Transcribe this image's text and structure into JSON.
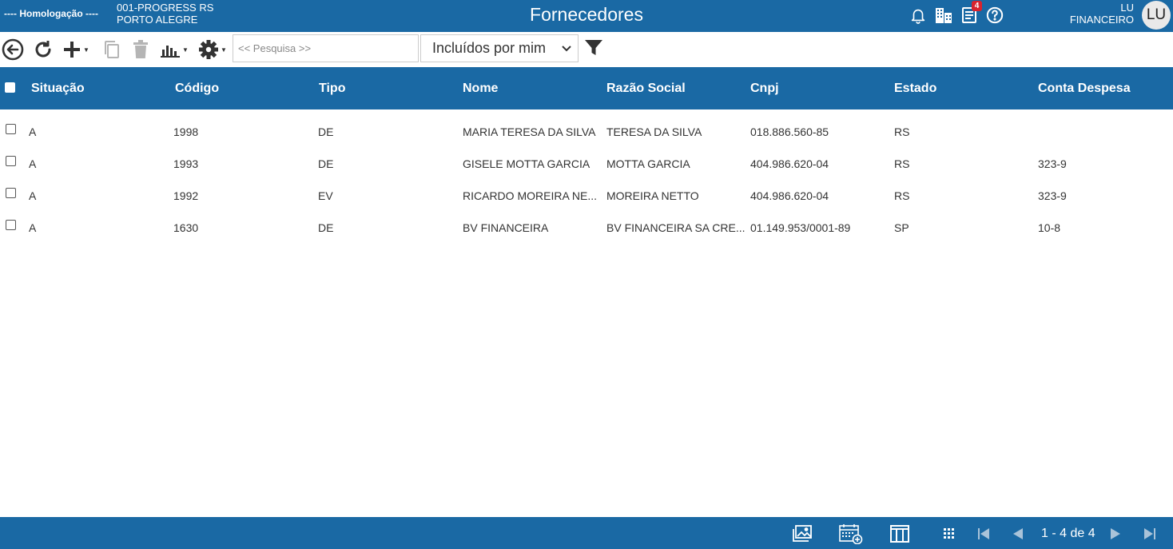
{
  "header": {
    "environment": "---- Homologação ----",
    "company_line1": "001-PROGRESS RS",
    "company_line2": "PORTO ALEGRE",
    "title": "Fornecedores",
    "notifications_badge": "4",
    "user_name": "LU",
    "user_role": "FINANCEIRO",
    "avatar_initials": "LU",
    "icons": [
      "bell-icon",
      "buildings-icon",
      "document-icon",
      "help-icon"
    ]
  },
  "toolbar": {
    "search_placeholder": "<< Pesquisa >>",
    "filter_selected": "Incluídos por mim",
    "icons": [
      "back-icon",
      "refresh-icon",
      "plus-icon",
      "copy-icon",
      "trash-icon",
      "chart-icon",
      "gear-icon",
      "funnel-icon"
    ]
  },
  "table": {
    "columns": [
      "Situação",
      "Código",
      "Tipo",
      "Nome",
      "Razão Social",
      "Cnpj",
      "Estado",
      "Conta Despesa"
    ],
    "rows": [
      [
        "A",
        "1998",
        "DE",
        "MARIA TERESA DA SILVA",
        "TERESA DA SILVA",
        "018.886.560-85",
        "RS",
        ""
      ],
      [
        "A",
        "1993",
        "DE",
        "GISELE MOTTA GARCIA",
        "MOTTA GARCIA",
        "404.986.620-04",
        "RS",
        "323-9"
      ],
      [
        "A",
        "1992",
        "EV",
        "RICARDO MOREIRA NE...",
        "MOREIRA NETTO",
        "404.986.620-04",
        "RS",
        "323-9"
      ],
      [
        "A",
        "1630",
        "DE",
        "BV FINANCEIRA",
        "BV FINANCEIRA SA CRE...",
        "01.149.953/0001-89",
        "SP",
        "10-8"
      ]
    ]
  },
  "footer": {
    "pagination": "1 - 4 de 4",
    "icons": [
      "images-icon",
      "calendar-add-icon",
      "columns-icon",
      "grid-icon",
      "first-page-icon",
      "prev-page-icon",
      "next-page-icon",
      "last-page-icon"
    ]
  },
  "colors": {
    "primary": "#1a69a4",
    "badge": "#d9232e",
    "disabled_icon": "#b5b5b5"
  }
}
